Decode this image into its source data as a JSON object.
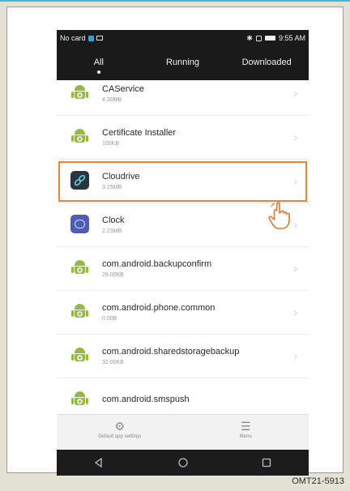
{
  "status_bar": {
    "carrier": "No card",
    "time": "9:55 AM"
  },
  "tabs": [
    {
      "label": "All",
      "active": true
    },
    {
      "label": "Running",
      "active": false
    },
    {
      "label": "Downloaded",
      "active": false
    }
  ],
  "apps": [
    {
      "name": "CAService",
      "size": "4.30MB",
      "icon": "android-app-icon"
    },
    {
      "name": "Certificate Installer",
      "size": "100KB",
      "icon": "android-app-icon"
    },
    {
      "name": "Cloudrive",
      "size": "3.15MB",
      "icon": "cloudrive-app-icon",
      "highlighted": true
    },
    {
      "name": "Clock",
      "size": "2.23MB",
      "icon": "clock-app-icon"
    },
    {
      "name": "com.android.backupconfirm",
      "size": "28.00KB",
      "icon": "android-app-icon"
    },
    {
      "name": "com.android.phone.common",
      "size": "0.00B",
      "icon": "android-app-icon"
    },
    {
      "name": "com.android.sharedstoragebackup",
      "size": "32.00KB",
      "icon": "android-app-icon"
    },
    {
      "name": "com.android.smspush",
      "size": "",
      "icon": "android-app-icon"
    }
  ],
  "bottom_bar": {
    "default_settings_label": "Default app settings",
    "menu_label": "Menu"
  },
  "nav_bar": {
    "back": "back-icon",
    "home": "home-icon",
    "recents": "recents-icon"
  },
  "caption": "OMT21-5913",
  "colors": {
    "highlight": "#ee8434",
    "android_green": "#95ba3d",
    "status_bar": "#1a1a1a",
    "clock_icon": "#4f5bb8"
  }
}
